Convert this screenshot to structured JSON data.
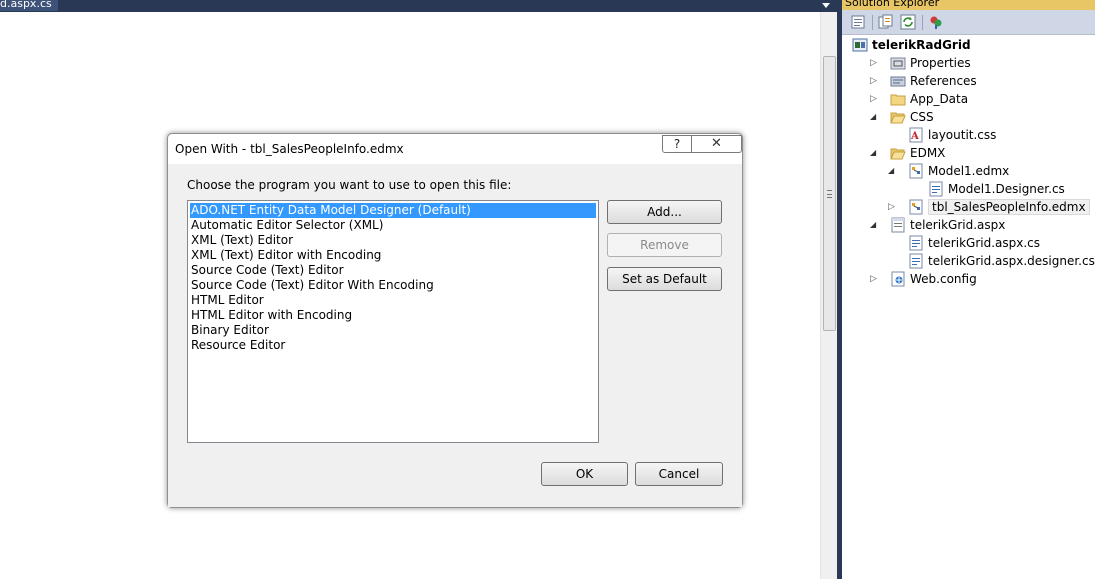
{
  "document_tab": {
    "title": "d.aspx.cs"
  },
  "solution_explorer": {
    "title": "Solution Explorer",
    "tree": [
      {
        "label": "telerikRadGrid",
        "icon": "csharp-project-icon",
        "level": 0,
        "expander": "none",
        "bold": true
      },
      {
        "label": "Properties",
        "icon": "properties-icon",
        "level": 1,
        "expander": "collapsed"
      },
      {
        "label": "References",
        "icon": "references-icon",
        "level": 1,
        "expander": "collapsed"
      },
      {
        "label": "App_Data",
        "icon": "folder-icon",
        "level": 1,
        "expander": "collapsed"
      },
      {
        "label": "CSS",
        "icon": "folder-open-icon",
        "level": 1,
        "expander": "expanded"
      },
      {
        "label": "layoutit.css",
        "icon": "css-file-icon",
        "level": 2,
        "expander": "none"
      },
      {
        "label": "EDMX",
        "icon": "folder-open-icon",
        "level": 1,
        "expander": "expanded"
      },
      {
        "label": "Model1.edmx",
        "icon": "edmx-file-icon",
        "level": 2,
        "expander": "expanded"
      },
      {
        "label": "Model1.Designer.cs",
        "icon": "cs-file-icon",
        "level": 3,
        "expander": "none"
      },
      {
        "label": "tbl_SalesPeopleInfo.edmx",
        "icon": "edmx-file-icon",
        "level": 2,
        "expander": "collapsed",
        "selected": true
      },
      {
        "label": "telerikGrid.aspx",
        "icon": "aspx-file-icon",
        "level": 1,
        "expander": "expanded"
      },
      {
        "label": "telerikGrid.aspx.cs",
        "icon": "cs-file-icon",
        "level": 2,
        "expander": "none"
      },
      {
        "label": "telerikGrid.aspx.designer.cs",
        "icon": "cs-file-icon",
        "level": 2,
        "expander": "none"
      },
      {
        "label": "Web.config",
        "icon": "config-file-icon",
        "level": 1,
        "expander": "collapsed"
      }
    ]
  },
  "dialog": {
    "title": "Open With - tbl_SalesPeopleInfo.edmx",
    "help_label": "?",
    "close_label": "✕",
    "prompt": "Choose the program you want to use to open this file:",
    "programs": [
      "ADO.NET Entity Data Model Designer (Default)",
      "Automatic Editor Selector (XML)",
      "XML (Text) Editor",
      "XML (Text) Editor with Encoding",
      "Source Code (Text) Editor",
      "Source Code (Text) Editor With Encoding",
      "HTML Editor",
      "HTML Editor with Encoding",
      "Binary Editor",
      "Resource Editor"
    ],
    "selected_index": 0,
    "add_label": "Add...",
    "remove_label": "Remove",
    "set_default_label": "Set as Default",
    "ok_label": "OK",
    "cancel_label": "Cancel"
  },
  "colors": {
    "selection": "#3399ff",
    "vs_chrome": "#293955",
    "se_title": "#e8c666"
  }
}
